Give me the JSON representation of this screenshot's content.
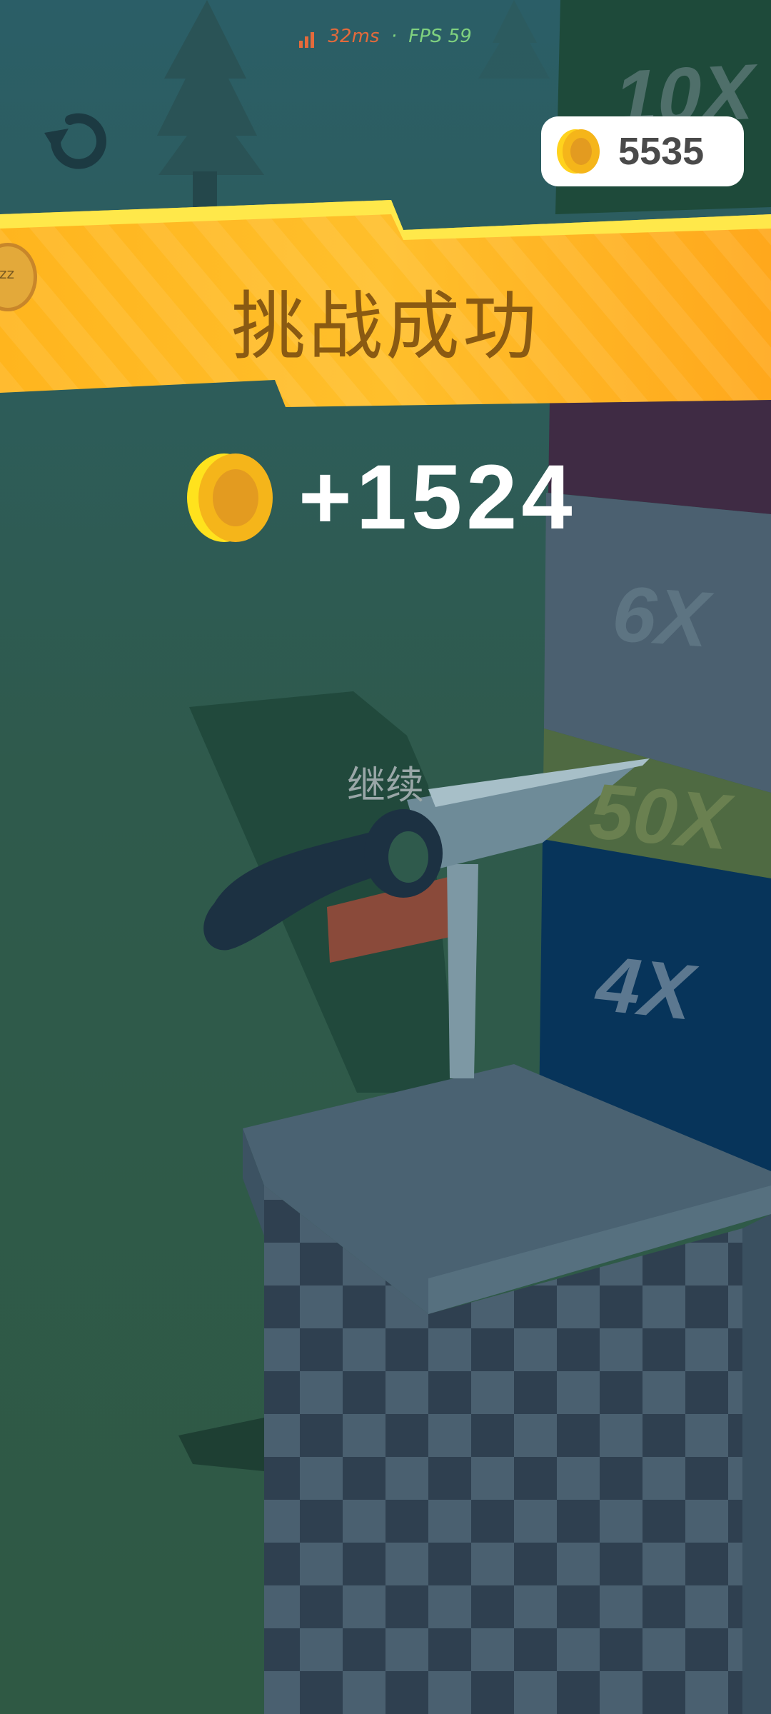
{
  "hud": {
    "latency": "32ms",
    "separator": "·",
    "fps": "FPS 59"
  },
  "coins": {
    "total": "5535"
  },
  "result": {
    "title": "挑战成功",
    "reward": "+1524"
  },
  "actions": {
    "continue_label": "继续"
  },
  "side_badge": {
    "label": "zz"
  },
  "multipliers": [
    "10X",
    "6X",
    "50X",
    "4X"
  ],
  "icons": {
    "restart": "restart-icon",
    "coin": "coin-icon"
  },
  "colors": {
    "banner": "#ffb224",
    "coin": "#f5c21b",
    "text_white": "#ffffff",
    "title": "#8a5a12"
  }
}
